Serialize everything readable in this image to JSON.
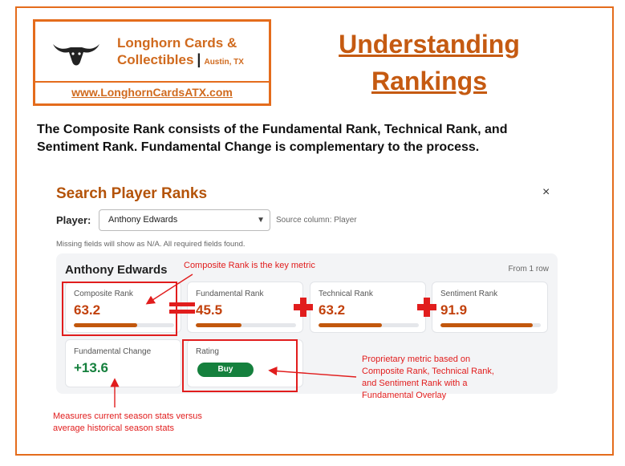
{
  "logo": {
    "name_line1": "Longhorn Cards &",
    "name_line2": "Collectibles",
    "city": "Austin, TX",
    "url": "www.LonghornCardsATX.com",
    "icon": "longhorn-head-icon"
  },
  "slide": {
    "title_line1": "Understanding",
    "title_line2": "Rankings",
    "intro_line1": "The Composite Rank consists of the Fundamental Rank, Technical Rank, and",
    "intro_line2": "Sentiment Rank.  Fundamental Change is complementary to the process."
  },
  "search": {
    "title": "Search Player Ranks",
    "close_icon": "×",
    "player_label": "Player:",
    "player_value": "Anthony Edwards",
    "source_note": "Source column: Player",
    "missing_note": "Missing fields will show as N/A. All required fields found."
  },
  "summary": {
    "player": "Anthony Edwards",
    "count": "From 1 row",
    "cards": [
      {
        "label": "Composite Rank",
        "value": "63.2",
        "fill": 0.632
      },
      {
        "label": "Fundamental Rank",
        "value": "45.5",
        "fill": 0.455
      },
      {
        "label": "Technical Rank",
        "value": "63.2",
        "fill": 0.632
      },
      {
        "label": "Sentiment Rank",
        "value": "91.9",
        "fill": 0.919
      }
    ],
    "change": {
      "label": "Fundamental Change",
      "value": "+13.6"
    },
    "rating": {
      "label": "Rating",
      "value": "Buy"
    }
  },
  "annotations": {
    "composite_note": "Composite Rank is the key metric",
    "rating_note": [
      "Proprietary metric based on",
      "Composite Rank, Technical Rank,",
      "and Sentiment Rank with a",
      "Fundamental Overlay"
    ],
    "change_note": [
      "Measures current season stats versus",
      "average historical season stats"
    ],
    "colors": {
      "accent": "#e46c1c",
      "annotation": "#e11d1d",
      "bar": "#c2570c",
      "positive": "#15803d"
    }
  }
}
